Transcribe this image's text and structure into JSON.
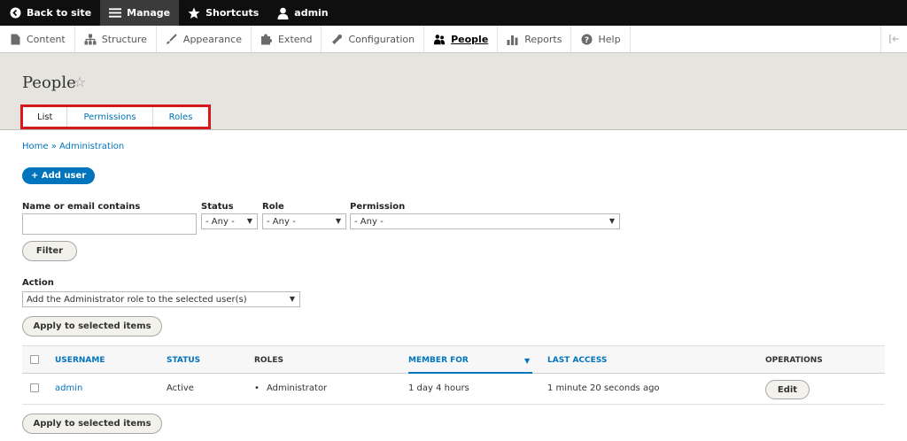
{
  "toolbar": {
    "back_to_site": "Back to site",
    "manage": "Manage",
    "shortcuts": "Shortcuts",
    "user": "admin"
  },
  "tray": {
    "items": [
      "Content",
      "Structure",
      "Appearance",
      "Extend",
      "Configuration",
      "People",
      "Reports",
      "Help"
    ],
    "active": "People"
  },
  "page": {
    "title": "People"
  },
  "tabs": {
    "list": "List",
    "permissions": "Permissions",
    "roles": "Roles"
  },
  "breadcrumb": "Home » Administration",
  "add_user": "+ Add user",
  "filters": {
    "name_label": "Name or email contains",
    "name_value": "",
    "status_label": "Status",
    "status_value": "- Any -",
    "role_label": "Role",
    "role_value": "- Any -",
    "permission_label": "Permission",
    "permission_value": "- Any -",
    "filter_button": "Filter"
  },
  "action": {
    "label": "Action",
    "value": "Add the Administrator role to the selected user(s)",
    "apply_button": "Apply to selected items"
  },
  "table": {
    "headers": {
      "username": "USERNAME",
      "status": "STATUS",
      "roles": "ROLES",
      "member_for": "MEMBER FOR",
      "last_access": "LAST ACCESS",
      "operations": "OPERATIONS"
    },
    "rows": [
      {
        "username": "admin",
        "status": "Active",
        "roles": "Administrator",
        "member_for": "1 day 4 hours",
        "last_access": "1 minute 20 seconds ago",
        "operation": "Edit"
      }
    ]
  },
  "bottom_apply_button": "Apply to selected items",
  "colors": {
    "link_blue": "#0074bd",
    "toolbar_black": "#0f0f0f",
    "header_bg": "#e6e4df",
    "highlight_red": "#d6191c"
  }
}
